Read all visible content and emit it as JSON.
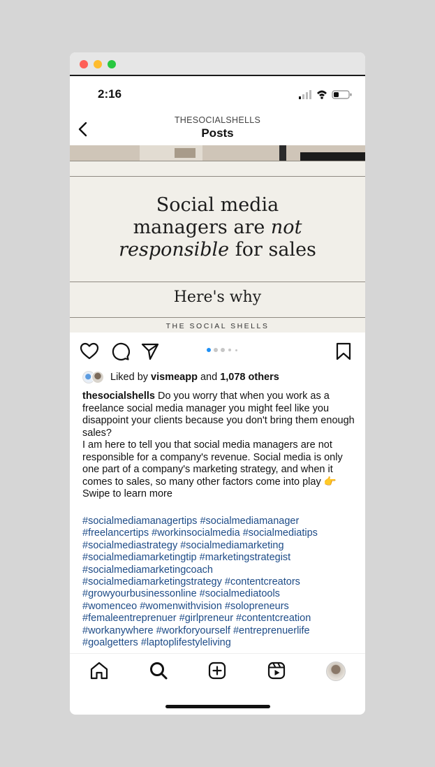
{
  "status_bar": {
    "time": "2:16"
  },
  "header": {
    "username": "THESOCIALSHELLS",
    "title": "Posts"
  },
  "slide": {
    "headline_line1": "Social media",
    "headline_line2_pre": "managers are ",
    "headline_line2_em": "not",
    "headline_line3_em": "responsible",
    "headline_line3_post": " for sales",
    "subheadline": "Here's why",
    "brand": "THE SOCIAL SHELLS"
  },
  "carousel": {
    "total_dots": 5,
    "active_index": 0
  },
  "likes": {
    "prefix": "Liked by ",
    "user": "vismeapp",
    "middle": " and ",
    "count": "1,078 others"
  },
  "caption": {
    "username": "thesocialshells",
    "text1": " Do you worry that when you work as a freelance social media manager you might feel like you disappoint your clients because you don't bring them enough sales?",
    "text2": "I am here to tell you that social media managers are not responsible for a company's revenue. Social media is only one part of a company's marketing strategy, and when it comes to sales, so many other factors come into play 👉 Swipe to learn more"
  },
  "hashtag_lines": [
    "#socialmediamanagertips #socialmediamanager",
    "#freelancertips #workinsocialmedia #socialmediatips",
    "#socialmediastrategy #socialmediamarketing",
    "#socialmediamarketingtip #marketingstrategist",
    "#socialmediamarketingcoach",
    "#socialmediamarketingstrategy #contentcreators",
    "#growyourbusinessonline #socialmediatools",
    "#womenceo #womenwithvision #solopreneurs",
    "#femaleentreprenuer #girlpreneur #contentcreation",
    "#workanywhere #workforyourself #entreprenuerlife",
    "#goalgetters #laptoplifestyleliving"
  ],
  "icons": {
    "back": "chevron-left-icon",
    "like": "heart-icon",
    "comment": "comment-icon",
    "share": "send-icon",
    "save": "bookmark-icon",
    "tabs": [
      "home-icon",
      "search-icon",
      "create-icon",
      "reels-icon",
      "profile-avatar"
    ]
  },
  "colors": {
    "hashtag": "#1d4b87",
    "carousel_active": "#1e90f5",
    "slide_background": "#f1efe9"
  }
}
